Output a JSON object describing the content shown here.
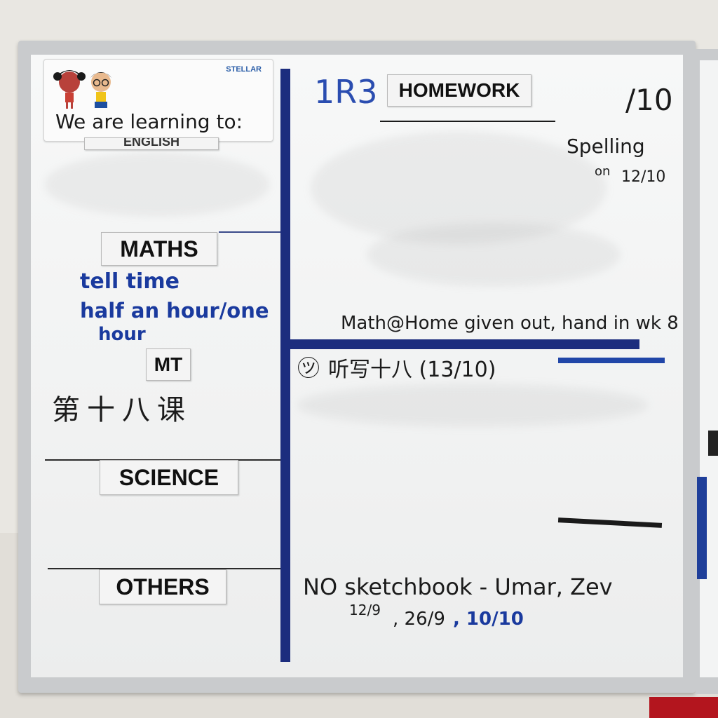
{
  "card": {
    "title": "We are learning to:",
    "logo": "STELLAR"
  },
  "subjects": {
    "english_label": "ENGLISH",
    "maths_label": "MATHS",
    "maths_text_1": "tell time",
    "maths_text_2": "half an hour/one",
    "maths_text_3": "hour",
    "mt_label": "MT",
    "mt_text": "第十八课",
    "science_label": "SCIENCE",
    "others_label": "OTHERS"
  },
  "homework": {
    "class_name": "1R3",
    "heading": "HOMEWORK",
    "date": "/10",
    "spelling_1": "Spelling",
    "spelling_2": "on",
    "spelling_date": "12/10",
    "math_home": "Math@Home given out, hand in wk 8",
    "chinese_dictation": "听写十八 (13/10)",
    "sketchbook": "NO sketchbook - Umar, Zev",
    "dates_1": "12/9",
    "dates_2": ", 26/9",
    "dates_3": ", 10/10"
  },
  "colors": {
    "marker_blue": "#1a3a9e",
    "tape_blue": "#1c2d7e",
    "board": "#f4f5f5",
    "frame": "#c9cbcd"
  }
}
